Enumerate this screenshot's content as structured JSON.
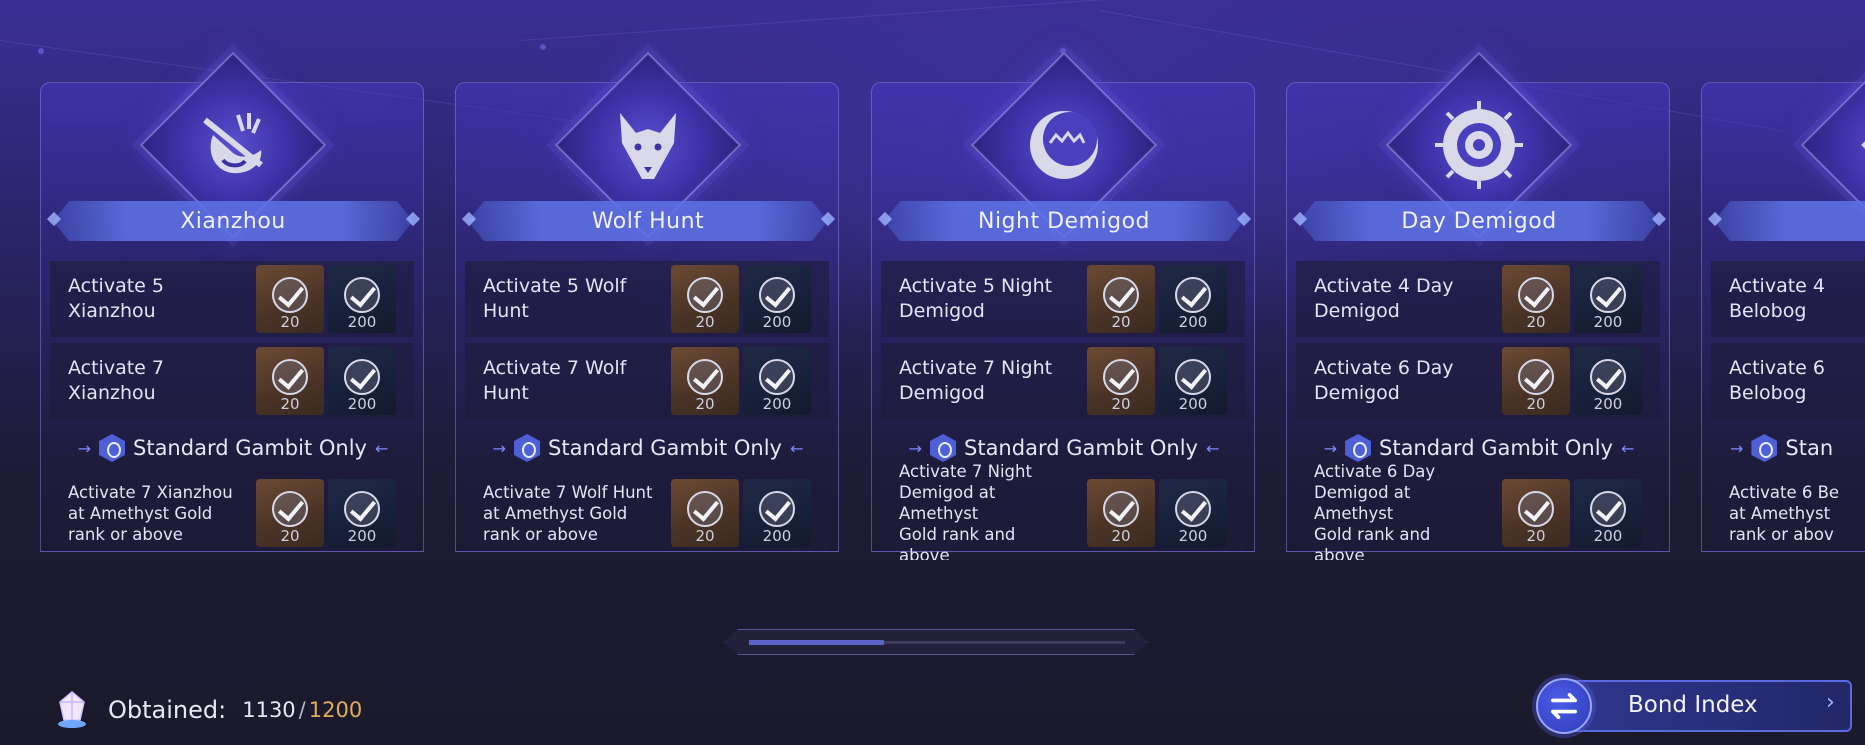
{
  "cards": [
    {
      "name": "Xianzhou",
      "icon": "xianzhou-icon",
      "objectives": [
        {
          "text_lines": [
            "Activate 5",
            "Xianzhou"
          ],
          "rewards": [
            20,
            200
          ]
        },
        {
          "text_lines": [
            "Activate 7",
            "Xianzhou"
          ],
          "rewards": [
            20,
            200
          ]
        }
      ],
      "gambit_label": "Standard Gambit Only",
      "special": {
        "text_lines": [
          "Activate 7 Xianzhou",
          "at Amethyst Gold",
          "rank or above"
        ],
        "rewards": [
          20,
          200
        ]
      }
    },
    {
      "name": "Wolf Hunt",
      "icon": "wolf-icon",
      "objectives": [
        {
          "text_lines": [
            "Activate 5 Wolf",
            "Hunt"
          ],
          "rewards": [
            20,
            200
          ]
        },
        {
          "text_lines": [
            "Activate 7 Wolf",
            "Hunt"
          ],
          "rewards": [
            20,
            200
          ]
        }
      ],
      "gambit_label": "Standard Gambit Only",
      "special": {
        "text_lines": [
          "Activate 7 Wolf Hunt",
          "at Amethyst Gold",
          "rank or above"
        ],
        "rewards": [
          20,
          200
        ]
      }
    },
    {
      "name": "Night Demigod",
      "icon": "crescent-moon-icon",
      "objectives": [
        {
          "text_lines": [
            "Activate 5 Night",
            "Demigod"
          ],
          "rewards": [
            20,
            200
          ]
        },
        {
          "text_lines": [
            "Activate 7 Night",
            "Demigod"
          ],
          "rewards": [
            20,
            200
          ]
        }
      ],
      "gambit_label": "Standard Gambit Only",
      "special": {
        "text_lines": [
          "Activate 7 Night",
          "Demigod at Amethyst",
          "Gold rank and above"
        ],
        "rewards": [
          20,
          200
        ]
      }
    },
    {
      "name": "Day Demigod",
      "icon": "sun-eye-icon",
      "objectives": [
        {
          "text_lines": [
            "Activate 4 Day",
            "Demigod"
          ],
          "rewards": [
            20,
            200
          ]
        },
        {
          "text_lines": [
            "Activate 6 Day",
            "Demigod"
          ],
          "rewards": [
            20,
            200
          ]
        }
      ],
      "gambit_label": "Standard Gambit Only",
      "special": {
        "text_lines": [
          "Activate 6 Day",
          "Demigod at Amethyst",
          "Gold rank and above"
        ],
        "rewards": [
          20,
          200
        ]
      }
    },
    {
      "name": "",
      "icon": "belobog-icon",
      "objectives": [
        {
          "text_lines": [
            "Activate 4",
            "Belobog"
          ],
          "rewards": []
        },
        {
          "text_lines": [
            "Activate 6",
            "Belobog"
          ],
          "rewards": []
        }
      ],
      "gambit_label": "Stan",
      "special": {
        "text_lines": [
          "Activate 6 Be",
          "at Amethyst",
          "rank or abov"
        ],
        "rewards": []
      }
    }
  ],
  "scroll": {
    "progress": 0.36
  },
  "footer": {
    "obtained_label": "Obtained:",
    "obtained_value": "1130",
    "separator": "/",
    "obtained_max": "1200",
    "icon": "crystal-icon"
  },
  "bond_index": {
    "label": "Bond Index",
    "icon": "swap-arrows-icon",
    "chevron": "chevron-right-icon"
  },
  "colors": {
    "accent": "#5b6ae0",
    "gold": "#e2ad5a",
    "plate": "#5f73e6"
  }
}
